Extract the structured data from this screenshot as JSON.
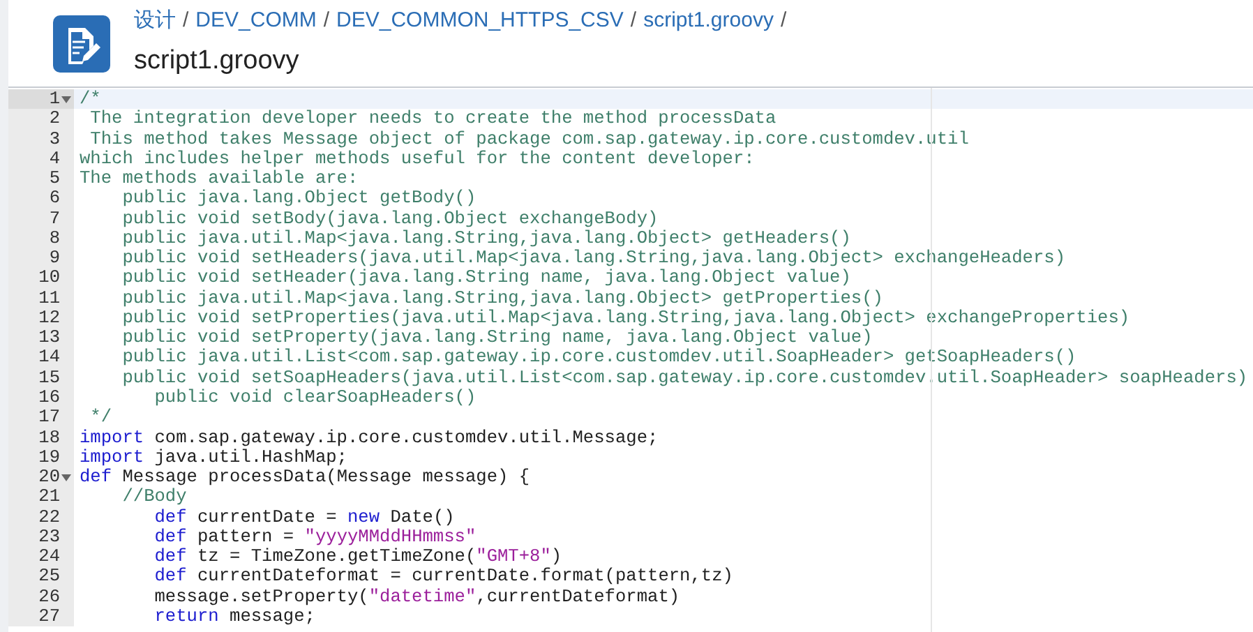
{
  "header": {
    "breadcrumb": [
      "设计",
      "DEV_COMM",
      "DEV_COMMON_HTTPS_CSV",
      "script1.groovy"
    ],
    "separator": "/",
    "title": "script1.groovy"
  },
  "editor": {
    "lines": [
      {
        "number": "1",
        "fold": true,
        "active": true,
        "segments": [
          {
            "kind": "comment",
            "text": "/*"
          }
        ]
      },
      {
        "number": "2",
        "fold": false,
        "active": false,
        "segments": [
          {
            "kind": "comment",
            "text": " The integration developer needs to create the method processData"
          }
        ]
      },
      {
        "number": "3",
        "fold": false,
        "active": false,
        "segments": [
          {
            "kind": "comment",
            "text": " This method takes Message object of package com.sap.gateway.ip.core.customdev.util"
          }
        ]
      },
      {
        "number": "4",
        "fold": false,
        "active": false,
        "segments": [
          {
            "kind": "comment",
            "text": "which includes helper methods useful for the content developer:"
          }
        ]
      },
      {
        "number": "5",
        "fold": false,
        "active": false,
        "segments": [
          {
            "kind": "comment",
            "text": "The methods available are:"
          }
        ]
      },
      {
        "number": "6",
        "fold": false,
        "active": false,
        "segments": [
          {
            "kind": "comment",
            "text": "    public java.lang.Object getBody()"
          }
        ]
      },
      {
        "number": "7",
        "fold": false,
        "active": false,
        "segments": [
          {
            "kind": "comment",
            "text": "    public void setBody(java.lang.Object exchangeBody)"
          }
        ]
      },
      {
        "number": "8",
        "fold": false,
        "active": false,
        "segments": [
          {
            "kind": "comment",
            "text": "    public java.util.Map<java.lang.String,java.lang.Object> getHeaders()"
          }
        ]
      },
      {
        "number": "9",
        "fold": false,
        "active": false,
        "segments": [
          {
            "kind": "comment",
            "text": "    public void setHeaders(java.util.Map<java.lang.String,java.lang.Object> exchangeHeaders)"
          }
        ]
      },
      {
        "number": "10",
        "fold": false,
        "active": false,
        "segments": [
          {
            "kind": "comment",
            "text": "    public void setHeader(java.lang.String name, java.lang.Object value)"
          }
        ]
      },
      {
        "number": "11",
        "fold": false,
        "active": false,
        "segments": [
          {
            "kind": "comment",
            "text": "    public java.util.Map<java.lang.String,java.lang.Object> getProperties()"
          }
        ]
      },
      {
        "number": "12",
        "fold": false,
        "active": false,
        "segments": [
          {
            "kind": "comment",
            "text": "    public void setProperties(java.util.Map<java.lang.String,java.lang.Object> exchangeProperties)"
          }
        ]
      },
      {
        "number": "13",
        "fold": false,
        "active": false,
        "segments": [
          {
            "kind": "comment",
            "text": "    public void setProperty(java.lang.String name, java.lang.Object value)"
          }
        ]
      },
      {
        "number": "14",
        "fold": false,
        "active": false,
        "segments": [
          {
            "kind": "comment",
            "text": "    public java.util.List<com.sap.gateway.ip.core.customdev.util.SoapHeader> getSoapHeaders()"
          }
        ]
      },
      {
        "number": "15",
        "fold": false,
        "active": false,
        "segments": [
          {
            "kind": "comment",
            "text": "    public void setSoapHeaders(java.util.List<com.sap.gateway.ip.core.customdev.util.SoapHeader> soapHeaders)"
          }
        ]
      },
      {
        "number": "16",
        "fold": false,
        "active": false,
        "segments": [
          {
            "kind": "comment",
            "text": "       public void clearSoapHeaders()"
          }
        ]
      },
      {
        "number": "17",
        "fold": false,
        "active": false,
        "segments": [
          {
            "kind": "comment",
            "text": " */"
          }
        ]
      },
      {
        "number": "18",
        "fold": false,
        "active": false,
        "segments": [
          {
            "kind": "keyword",
            "text": "import"
          },
          {
            "kind": "plain",
            "text": " com.sap.gateway.ip.core.customdev.util.Message;"
          }
        ]
      },
      {
        "number": "19",
        "fold": false,
        "active": false,
        "segments": [
          {
            "kind": "keyword",
            "text": "import"
          },
          {
            "kind": "plain",
            "text": " java.util.HashMap;"
          }
        ]
      },
      {
        "number": "20",
        "fold": true,
        "active": false,
        "segments": [
          {
            "kind": "keyword",
            "text": "def"
          },
          {
            "kind": "plain",
            "text": " Message processData(Message message) {"
          }
        ]
      },
      {
        "number": "21",
        "fold": false,
        "active": false,
        "segments": [
          {
            "kind": "comment",
            "text": "    //Body"
          }
        ]
      },
      {
        "number": "22",
        "fold": false,
        "active": false,
        "segments": [
          {
            "kind": "keyword",
            "text": "       def"
          },
          {
            "kind": "plain",
            "text": " currentDate = "
          },
          {
            "kind": "keyword",
            "text": "new"
          },
          {
            "kind": "plain",
            "text": " Date()"
          }
        ]
      },
      {
        "number": "23",
        "fold": false,
        "active": false,
        "segments": [
          {
            "kind": "keyword",
            "text": "       def"
          },
          {
            "kind": "plain",
            "text": " pattern = "
          },
          {
            "kind": "string",
            "text": "\"yyyyMMddHHmmss\""
          }
        ]
      },
      {
        "number": "24",
        "fold": false,
        "active": false,
        "segments": [
          {
            "kind": "keyword",
            "text": "       def"
          },
          {
            "kind": "plain",
            "text": " tz = TimeZone.getTimeZone("
          },
          {
            "kind": "string",
            "text": "\"GMT+8\""
          },
          {
            "kind": "plain",
            "text": ")"
          }
        ]
      },
      {
        "number": "25",
        "fold": false,
        "active": false,
        "segments": [
          {
            "kind": "keyword",
            "text": "       def"
          },
          {
            "kind": "plain",
            "text": " currentDateformat = currentDate.format(pattern,tz)"
          }
        ]
      },
      {
        "number": "26",
        "fold": false,
        "active": false,
        "segments": [
          {
            "kind": "plain",
            "text": "       message.setProperty("
          },
          {
            "kind": "string",
            "text": "\"datetime\""
          },
          {
            "kind": "plain",
            "text": ",currentDateformat)"
          }
        ]
      },
      {
        "number": "27",
        "fold": false,
        "active": false,
        "segments": [
          {
            "kind": "keyword",
            "text": "       return"
          },
          {
            "kind": "plain",
            "text": " message;"
          }
        ]
      }
    ]
  }
}
